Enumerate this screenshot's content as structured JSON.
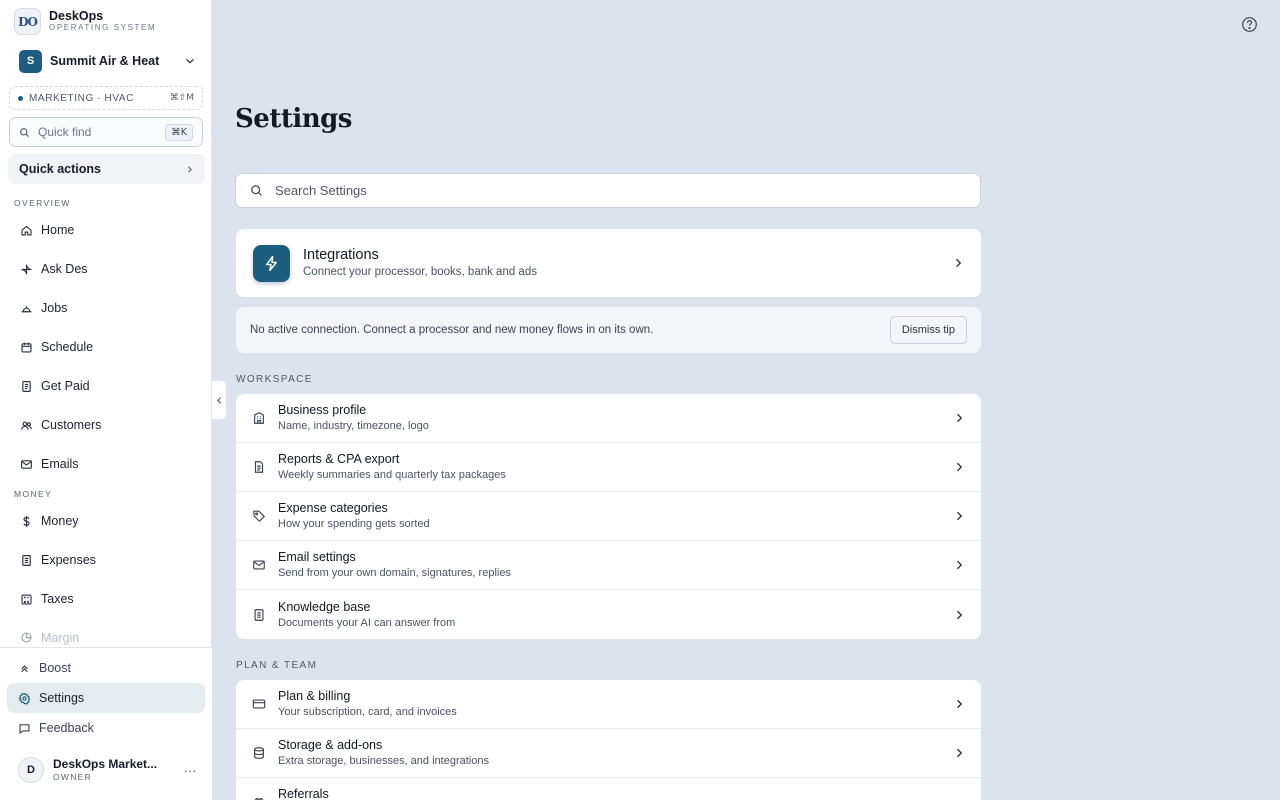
{
  "brand": {
    "logo": "DO",
    "name": "DeskOps",
    "subtitle": "OPERATING SYSTEM"
  },
  "business": {
    "initial": "S",
    "name": "Summit Air & Heat"
  },
  "mode": {
    "label": "MARKETING · HVAC",
    "shortcut": "⌘⇧M"
  },
  "quick_find": {
    "placeholder": "Quick find",
    "shortcut": "⌘K"
  },
  "quick_actions": "Quick actions",
  "sidebar": {
    "overview_label": "OVERVIEW",
    "overview": [
      {
        "label": "Home",
        "icon": "home-icon"
      },
      {
        "label": "Ask Des",
        "icon": "sparkle-icon"
      },
      {
        "label": "Jobs",
        "icon": "jobs-icon"
      },
      {
        "label": "Schedule",
        "icon": "calendar-icon"
      },
      {
        "label": "Get Paid",
        "icon": "invoice-icon"
      },
      {
        "label": "Customers",
        "icon": "users-icon"
      },
      {
        "label": "Emails",
        "icon": "mail-icon"
      }
    ],
    "money_label": "MONEY",
    "money": [
      {
        "label": "Money",
        "icon": "dollar-icon"
      },
      {
        "label": "Expenses",
        "icon": "receipt-icon"
      },
      {
        "label": "Taxes",
        "icon": "calculator-icon"
      },
      {
        "label": "Margin",
        "icon": "pie-icon"
      }
    ],
    "bottom": [
      {
        "label": "Boost",
        "icon": "chevrons-up-icon"
      },
      {
        "label": "Settings",
        "icon": "gear-icon"
      },
      {
        "label": "Feedback",
        "icon": "chat-icon"
      }
    ]
  },
  "user": {
    "initial": "D",
    "name": "DeskOps Market...",
    "role": "OWNER",
    "more": "···"
  },
  "page": {
    "title": "Settings",
    "search_placeholder": "Search Settings"
  },
  "integrations": {
    "title": "Integrations",
    "subtitle": "Connect your processor, books, bank and ads"
  },
  "tip": {
    "text": "No active connection. Connect a processor and new money flows in on its own.",
    "button": "Dismiss tip"
  },
  "workspace": {
    "label": "WORKSPACE",
    "items": [
      {
        "title": "Business profile",
        "subtitle": "Name, industry, timezone, logo",
        "icon": "building-icon"
      },
      {
        "title": "Reports & CPA export",
        "subtitle": "Weekly summaries and quarterly tax packages",
        "icon": "document-icon"
      },
      {
        "title": "Expense categories",
        "subtitle": "How your spending gets sorted",
        "icon": "tag-icon"
      },
      {
        "title": "Email settings",
        "subtitle": "Send from your own domain, signatures, replies",
        "icon": "mail-icon"
      },
      {
        "title": "Knowledge base",
        "subtitle": "Documents your AI can answer from",
        "icon": "book-icon"
      }
    ]
  },
  "plan_team": {
    "label": "PLAN & TEAM",
    "items": [
      {
        "title": "Plan & billing",
        "subtitle": "Your subscription, card, and invoices",
        "icon": "credit-card-icon"
      },
      {
        "title": "Storage & add-ons",
        "subtitle": "Extra storage, businesses, and integrations",
        "icon": "database-icon"
      },
      {
        "title": "Referrals",
        "subtitle": "",
        "icon": "gift-icon"
      }
    ]
  },
  "colors": {
    "accent": "#1d5e80",
    "background": "#dde3ec",
    "active_nav": "#e5ecef"
  }
}
